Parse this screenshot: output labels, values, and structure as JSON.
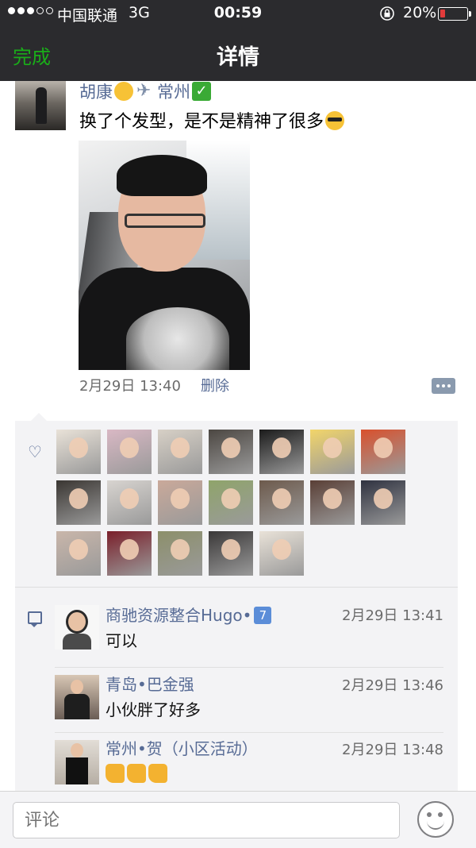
{
  "status_bar": {
    "carrier": "中国联通",
    "network": "3G",
    "time": "00:59",
    "battery_percent_label": "20%",
    "battery_level": 0.2,
    "battery_color": "#e23b3b",
    "icons": [
      "signal-dots-icon",
      "orientation-lock-icon",
      "battery-icon"
    ]
  },
  "nav": {
    "done_label": "完成",
    "title": "详情",
    "accent_color": "#1aad19"
  },
  "post": {
    "author_name": "胡康",
    "author_location": "常州",
    "author_emojis": [
      "smile-emoji",
      "airplane-emoji",
      "check-emoji"
    ],
    "text": "换了个发型，是不是精神了很多",
    "text_emoji": "cool-emoji",
    "timestamp": "2月29日 13:40",
    "delete_label": "删除"
  },
  "likes": {
    "icon": "heart-icon",
    "count": 19
  },
  "comments": [
    {
      "name": "商驰资源整合Hugo•",
      "badge": "7",
      "time": "2月29日 13:41",
      "text": "可以"
    },
    {
      "name": "青岛•巴金强",
      "time": "2月29日 13:46",
      "text": "小伙胖了好多"
    },
    {
      "name": "常州•贺（小区活动）",
      "time": "2月29日 13:48",
      "text": "",
      "thumbs_up_count": 3
    }
  ],
  "comment_bar": {
    "placeholder": "评论",
    "emoji_icon": "emoji-face-icon"
  },
  "colors": {
    "link_blue": "#576b95",
    "panel_bg": "#f3f3f5",
    "header_bg": "#2b2b2e"
  }
}
